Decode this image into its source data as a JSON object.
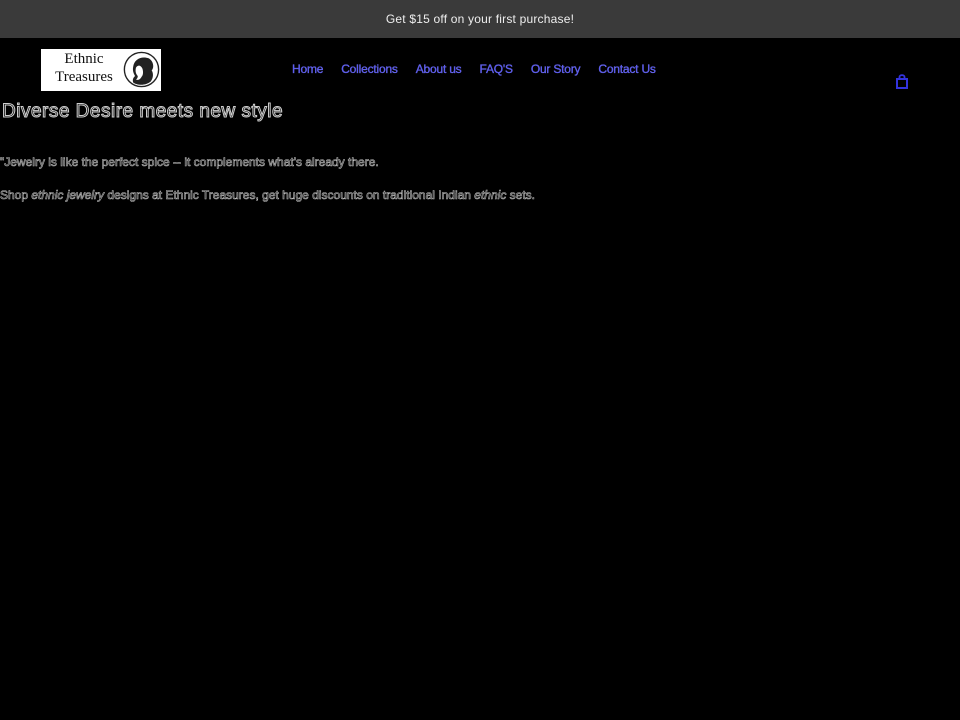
{
  "announcement": {
    "text": "Get $15 off on your first purchase!"
  },
  "brand": {
    "logo_line1": "Ethnic",
    "logo_line2": "Treasures"
  },
  "nav": {
    "items": [
      {
        "label": "Home"
      },
      {
        "label": "Collections"
      },
      {
        "label": "About us"
      },
      {
        "label": "FAQ'S"
      },
      {
        "label": "Our Story"
      },
      {
        "label": "Contact Us"
      }
    ],
    "cart_icon": "cart-icon"
  },
  "main": {
    "title": "Diverse Desire meets new style",
    "quote": "\"Jewelry is like the perfect spice -- it complements what's already there.",
    "shop": {
      "prefix": "Shop ",
      "emph1": "ethnic jewelry",
      "middle": " designs at Ethnic Treasures, get huge discounts on traditional Indian ",
      "emph2": "ethnic",
      "suffix": " sets."
    }
  },
  "colors": {
    "announcement_bg": "#3a3a3a",
    "nav_link": "#5555ee",
    "page_bg": "#000000"
  }
}
